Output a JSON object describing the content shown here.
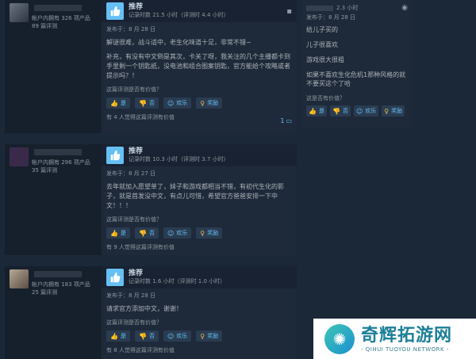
{
  "reviews": [
    {
      "author_stats_products": "帐户内拥有 326 项产品",
      "author_stats_reviews": "89 篇评测",
      "vote": "推荐",
      "hours": "记录时数 21.5 小时（评测时 4.4 小时）",
      "posted": "发布于：8 月 28 日",
      "paragraphs": [
        "解谜很难，战斗适中，老生化味道十足，非常不错~",
        "补充，有没有中文倒是其次，卡关了呀，我关注的几个主播都卡到手里剩一个钥匙纸，没电池和组合图案钥匙，官方能给个攻略或者提示吗？！"
      ],
      "helpful_q": "这篇评测是否有价值？",
      "btn_yes": "是",
      "btn_no": "否",
      "btn_funny": "欢乐",
      "btn_award": "奖励",
      "found": "有 4 人觉得这篇评测有价值",
      "comments": "1"
    },
    {
      "author_stats_products": "帐户内拥有 296 项产品",
      "author_stats_reviews": "35 篇评测",
      "vote": "推荐",
      "hours": "记录时数 10.3 小时（评测时 3.7 小时）",
      "posted": "发布于：8 月 27 日",
      "paragraphs": [
        "去年就加入愿望单了，妹子和游戏都相当不错，有初代生化的影子，就是首发没中文，有点儿可惜，希望官方爸爸安排一下中文！！！"
      ],
      "helpful_q": "这篇评测是否有价值？",
      "btn_yes": "是",
      "btn_no": "否",
      "btn_funny": "欢乐",
      "btn_award": "奖励",
      "found": "有 9 人觉得这篇评测有价值"
    },
    {
      "author_stats_products": "帐户内拥有 183 项产品",
      "author_stats_reviews": "25 篇评测",
      "vote": "推荐",
      "hours": "记录时数 1.6 小时（评测时 1.0 小时）",
      "posted": "发布于：8 月 28 日",
      "paragraphs": [
        "请求官方添加中文，谢谢！"
      ],
      "helpful_q": "这篇评测是否有价值？",
      "btn_yes": "是",
      "btn_no": "否",
      "btn_funny": "欢乐",
      "btn_award": "奖励",
      "found": "有 8 人觉得这篇评测有价值"
    }
  ],
  "side_review": {
    "hours": "2.3 小时",
    "posted": "发布于：8 月 28 日",
    "lines": [
      "给儿子买的",
      "儿子很喜欢",
      "游戏很大很粗",
      "如果不喜欢生化危机1那种风格的就不要买这个了哈"
    ],
    "helpful_q": "这是否有价值？",
    "btn_yes": "是",
    "btn_no": "否",
    "btn_funny": "欢乐",
    "btn_award": "奖励"
  },
  "watermark": {
    "cn": "奇辉拓游网",
    "en": "- QIHUI TUOYOU NETWORK -"
  },
  "colors": {
    "accent": "#66c0f4",
    "background": "#1b2838",
    "award": "#e7b94f"
  }
}
